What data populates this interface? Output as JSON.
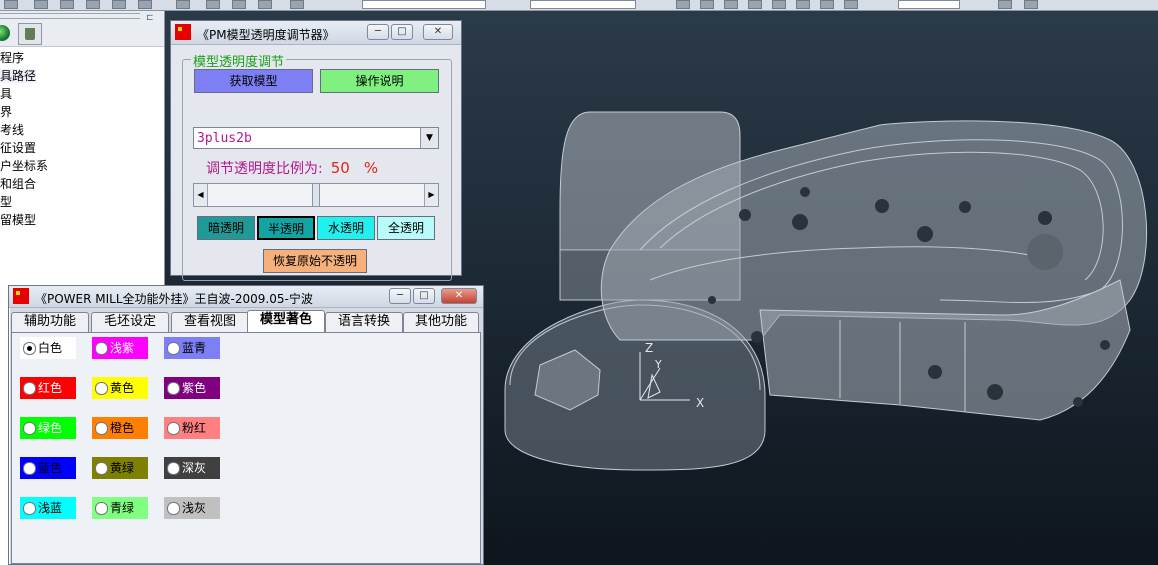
{
  "colors": {
    "viewport_top": "#2c3b4a",
    "viewport_bottom": "#0e151c",
    "btn_blue": "#7f7ff5",
    "btn_green": "#80f080",
    "btn_teal_dark": "#1f9a96",
    "btn_teal": "#14a3a3",
    "btn_cyan": "#22f0ee",
    "btn_cyan_light": "#b9fbfb",
    "btn_orange": "#f6b07c",
    "magenta_text": "#b4178e",
    "red_text": "#e2241f",
    "legend_green": "#1aa01a"
  },
  "explorer": {
    "tree": [
      "程序",
      "具路径",
      "具",
      "界",
      "考线",
      "征设置",
      "户坐标系",
      "和组合",
      "型",
      "留模型"
    ]
  },
  "pm_window": {
    "title": "《PM模型透明度调节器》",
    "group_legend": "模型透明度调节",
    "get_model": "获取模型",
    "instructions": "操作说明",
    "combo_value": "3plus2b",
    "ratio_label": "调节透明度比例为:",
    "ratio_value": "50",
    "ratio_unit": "%",
    "slider_position": 0.5,
    "btn_dark": "暗透明",
    "btn_half": "半透明",
    "btn_water": "水透明",
    "btn_full": "全透明",
    "btn_restore": "恢复原始不透明"
  },
  "main_window": {
    "title": "《POWER MILL全功能外挂》王自波-2009.05-宁波",
    "tabs": [
      "辅助功能",
      "毛坯设定",
      "查看视图",
      "模型著色",
      "语言转换",
      "其他功能"
    ],
    "active_tab": 3,
    "colors": [
      {
        "label": "白色",
        "bg": "#ffffff",
        "fg": "#000000",
        "checked": true
      },
      {
        "label": "浅紫",
        "bg": "#ff00ff",
        "fg": "#ffffff",
        "checked": false
      },
      {
        "label": "蓝青",
        "bg": "#7f7ff5",
        "fg": "#000000",
        "checked": false
      },
      {
        "label": "红色",
        "bg": "#ff0000",
        "fg": "#ffffff",
        "checked": false
      },
      {
        "label": "黄色",
        "bg": "#ffff00",
        "fg": "#000000",
        "checked": false
      },
      {
        "label": "紫色",
        "bg": "#800080",
        "fg": "#ffffff",
        "checked": false
      },
      {
        "label": "绿色",
        "bg": "#00ff00",
        "fg": "#ffffff",
        "checked": false
      },
      {
        "label": "橙色",
        "bg": "#ff8000",
        "fg": "#000000",
        "checked": false
      },
      {
        "label": "粉红",
        "bg": "#ff8080",
        "fg": "#000000",
        "checked": false
      },
      {
        "label": "蓝色",
        "bg": "#0000ff",
        "fg": "#000000",
        "checked": false
      },
      {
        "label": "黄绿",
        "bg": "#808000",
        "fg": "#000000",
        "checked": false
      },
      {
        "label": "深灰",
        "bg": "#404040",
        "fg": "#ffffff",
        "checked": false
      },
      {
        "label": "浅蓝",
        "bg": "#00ffff",
        "fg": "#000000",
        "checked": false
      },
      {
        "label": "青绿",
        "bg": "#80ff80",
        "fg": "#000000",
        "checked": false
      },
      {
        "label": "浅灰",
        "bg": "#c0c0c0",
        "fg": "#000000",
        "checked": false
      }
    ]
  },
  "axes": {
    "z": "Z",
    "y": "Y",
    "x": "X"
  }
}
